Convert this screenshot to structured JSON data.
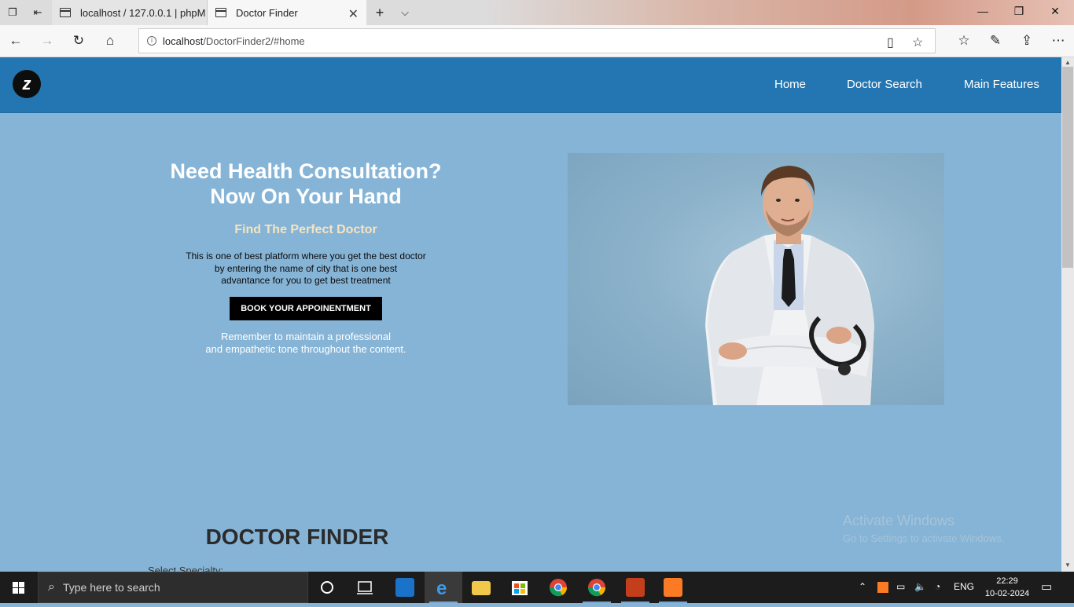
{
  "browser": {
    "tabs": [
      {
        "title": "localhost / 127.0.0.1 | phpM"
      },
      {
        "title": "Doctor Finder"
      }
    ],
    "url_host": "localhost",
    "url_path": "/DoctorFinder2/#home"
  },
  "site": {
    "nav": [
      "Home",
      "Doctor Search",
      "Main Features"
    ],
    "hero": {
      "title_line1": "Need Health Consultation?",
      "title_line2": "Now On Your Hand",
      "subtitle": "Find The Perfect Doctor",
      "desc_line1": "This is one of best platform where you get the best doctor",
      "desc_line2": "by entering the name of city that is one best",
      "desc_line3": "advantance for you to get best treatment",
      "button": "BOOK YOUR APPOINENTMENT",
      "note_line1": "Remember to maintain a professional",
      "note_line2": "and empathetic tone throughout the content."
    },
    "finder": {
      "title": "DOCTOR FINDER",
      "specialty_label": "Select Specialty:"
    },
    "colors": {
      "nav_bg": "#2376b1",
      "page_bg": "#86b4d6",
      "subtitle": "#f5e4c0"
    }
  },
  "watermark": {
    "line1": "Activate Windows",
    "line2": "Go to Settings to activate Windows."
  },
  "taskbar": {
    "search_placeholder": "Type here to search",
    "language": "ENG",
    "time": "22:29",
    "date": "10-02-2024"
  }
}
